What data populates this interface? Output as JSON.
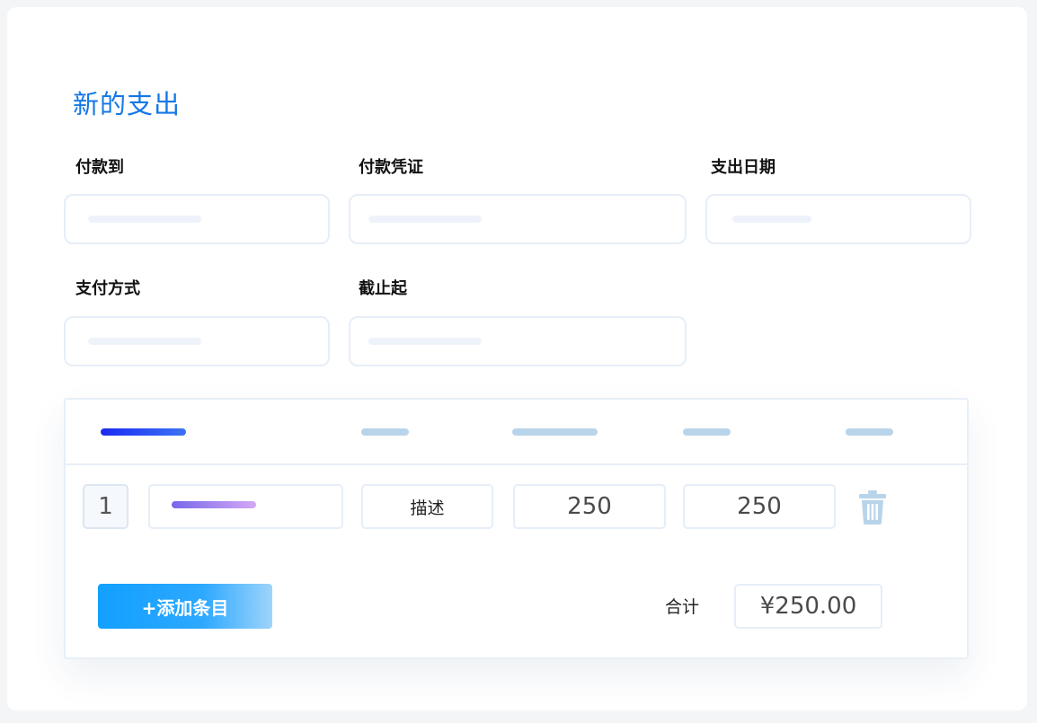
{
  "form": {
    "title": "新的支出",
    "fields": [
      {
        "label": "付款到",
        "value": ""
      },
      {
        "label": "付款凭证",
        "value": ""
      },
      {
        "label": "支出日期",
        "value": ""
      },
      {
        "label": "支付方式",
        "value": ""
      },
      {
        "label": "截止起",
        "value": ""
      }
    ]
  },
  "items_table": {
    "rows": [
      {
        "index": "1",
        "description": "描述",
        "amount_1": "250",
        "amount_2": "250"
      }
    ],
    "add_item_label": "+添加条目",
    "total_label": "合计",
    "total_value": "¥250.00"
  },
  "icons": {
    "delete": "trash-icon"
  },
  "colors": {
    "title": "#1478e6",
    "accent_blue": "#12a0ff",
    "header_primary": "#1a2bf0",
    "placeholder_bar": "#b8d4ea",
    "trash_icon": "#b8d4ea"
  }
}
